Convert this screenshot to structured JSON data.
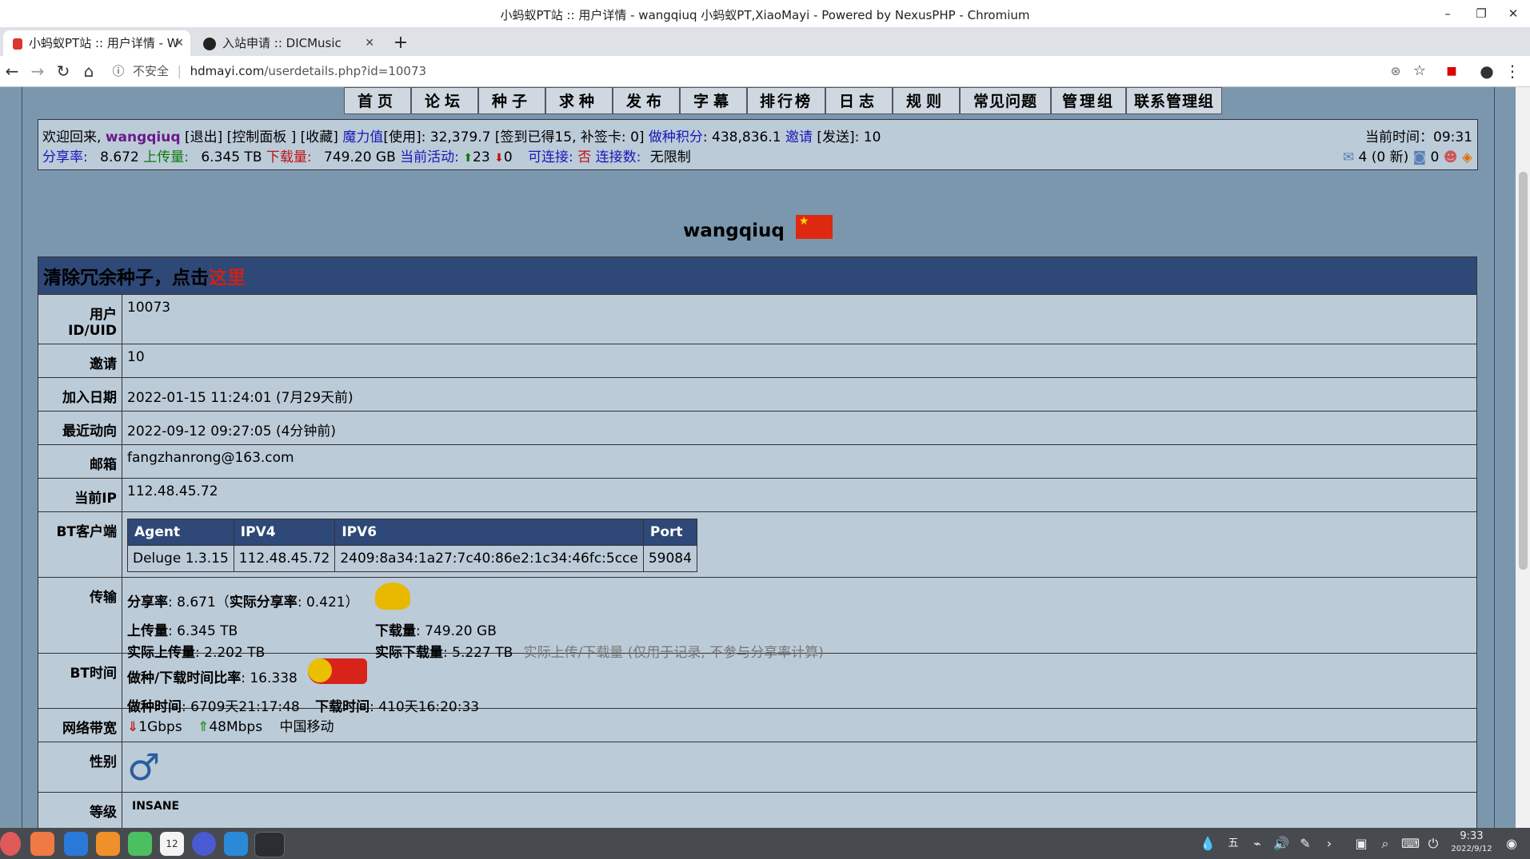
{
  "window": {
    "title": "小蚂蚁PT站 :: 用户详情 - wangqiuq 小蚂蚁PT,XiaoMayi - Powered by NexusPHP - Chromium"
  },
  "tabs": [
    {
      "label": "小蚂蚁PT站 :: 用户详情 - W"
    },
    {
      "label": "入站申请 :: DICMusic"
    }
  ],
  "address": {
    "security": "不安全",
    "host": "hdmayi.com",
    "path": "/userdetails.php?id=10073"
  },
  "nav": [
    "首页",
    "论坛",
    "种子",
    "求种",
    "发布",
    "字幕",
    "排行榜",
    "日志",
    "规则",
    "常见问题",
    "管理组",
    "联系管理组"
  ],
  "infobar": {
    "welcome": "欢迎回来,",
    "user": "wangqiuq",
    "links_a": "[退出] [控制面板 ] [收藏]",
    "bonus_label": "魔力值",
    "bonus_text": "[使用]: 32,379.7 [签到已得15, 补签卡: 0]",
    "seed_points_label": "做种积分",
    "seed_points_value": ": 438,836.1",
    "invite_label": "邀请",
    "invite_value": "[发送]: 10",
    "time_label": "当前时间：",
    "time_value": "09:31",
    "ratio_label": "分享率:",
    "ratio_value": "8.672",
    "up_label": "上传量:",
    "up_value": "6.345 TB",
    "down_label": "下载量:",
    "down_value": "749.20 GB",
    "active_label": "当前活动:",
    "active_up": "23",
    "active_down": "0",
    "conn_label": "可连接:",
    "conn_value": "否",
    "conns_label": "连接数:",
    "conns_value": "无限制",
    "msg_value": "4 (0 新)",
    "friends_value": "0"
  },
  "profile": {
    "username": "wangqiuq",
    "banner_text": "清除冗余种子，点击",
    "banner_link": "这里",
    "rows": {
      "uid_label": "用户ID/UID",
      "uid": "10073",
      "invite_label": "邀请",
      "invite": "10",
      "join_label": "加入日期",
      "join": "2022-01-15 11:24:01 (7月29天前)",
      "last_label": "最近动向",
      "last": "2022-09-12 09:27:05 (4分钟前)",
      "email_label": "邮箱",
      "email": "fangzhanrong@163.com",
      "ip_label": "当前IP",
      "ip": "112.48.45.72",
      "client_label": "BT客户端",
      "transfer_label": "传输",
      "bttime_label": "BT时间",
      "bandwidth_label": "网络带宽",
      "gender_label": "性别",
      "class_label": "等级"
    },
    "client_table": {
      "headers": [
        "Agent",
        "IPV4",
        "IPV6",
        "Port"
      ],
      "row": [
        "Deluge 1.3.15",
        "112.48.45.72",
        "2409:8a34:1a27:7c40:86e2:1c34:46fc:5cce",
        "59084"
      ]
    },
    "transfer": {
      "ratio_label": "分享率",
      "ratio_value": ": 8.671（",
      "real_ratio_label": "实际分享率",
      "real_ratio_value": ": 0.421）",
      "up_label": "上传量",
      "up_value": ": 6.345 TB",
      "down_label": "下载量",
      "down_value": ": 749.20 GB",
      "real_up_label": "实际上传量",
      "real_up_value": ": 2.202 TB",
      "real_down_label": "实际下载量",
      "real_down_value": ": 5.227 TB",
      "note": "实际上传/下载量 (仅用于记录, 不参与分享率计算)"
    },
    "bttime": {
      "ratio_label": "做种/下载时间比率",
      "ratio_value": ": 16.338",
      "seed_label": "做种时间",
      "seed_value": ": 6709天21:17:48",
      "down_label": "下载时间",
      "down_value": ": 410天16:20:33"
    },
    "bandwidth": {
      "down": "1Gbps",
      "up": "48Mbps",
      "isp": "中国移动"
    },
    "class_text": "INSANE"
  },
  "taskbar": {
    "time": "9:33",
    "date": "2022/9/12",
    "calendar_day": "12",
    "ime": "五"
  }
}
